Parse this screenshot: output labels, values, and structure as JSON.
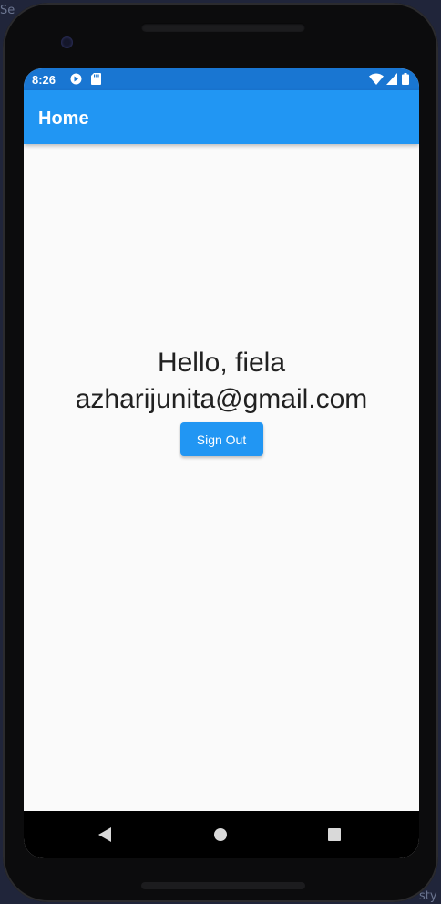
{
  "background_text": {
    "top_left": "Se",
    "bottom_right": "sty"
  },
  "status_bar": {
    "time": "8:26",
    "icons": [
      "google-play-icon",
      "sd-card-icon",
      "wifi-icon",
      "signal-icon",
      "battery-icon"
    ]
  },
  "app_bar": {
    "title": "Home"
  },
  "content": {
    "greeting": "Hello, fiela",
    "email": "azharijunita@gmail.com",
    "sign_out_label": "Sign Out"
  },
  "nav_bar": {
    "buttons": [
      "back",
      "home",
      "recents"
    ]
  },
  "colors": {
    "status_bar": "#1976d2",
    "app_bar": "#2196f3",
    "button": "#2196f3",
    "screen_background": "#fafafa"
  }
}
